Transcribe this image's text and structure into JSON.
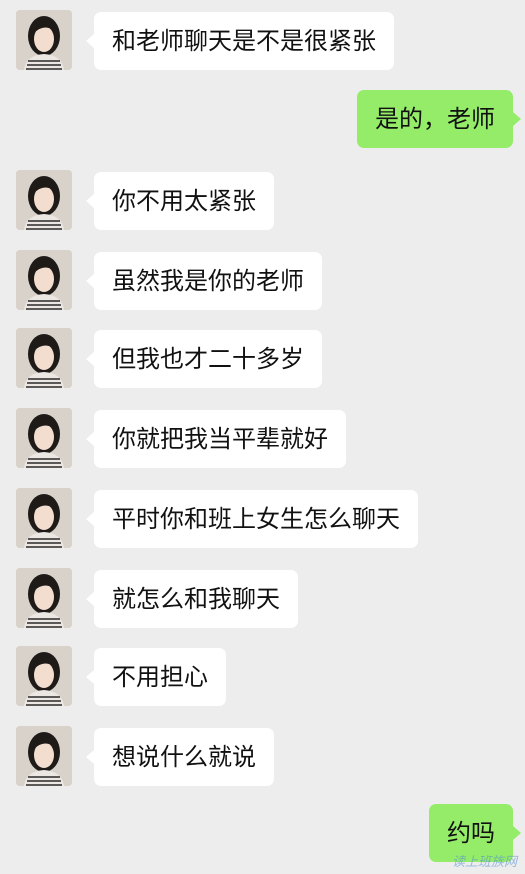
{
  "messages": [
    {
      "side": "in",
      "text": "和老师聊天是不是很紧张"
    },
    {
      "side": "out",
      "text": "是的，老师"
    },
    {
      "side": "in",
      "text": "你不用太紧张"
    },
    {
      "side": "in",
      "text": "虽然我是你的老师"
    },
    {
      "side": "in",
      "text": "但我也才二十多岁"
    },
    {
      "side": "in",
      "text": "你就把我当平辈就好"
    },
    {
      "side": "in",
      "text": "平时你和班上女生怎么聊天"
    },
    {
      "side": "in",
      "text": "就怎么和我聊天"
    },
    {
      "side": "in",
      "text": "不用担心"
    },
    {
      "side": "in",
      "text": "想说什么就说"
    },
    {
      "side": "out",
      "text": "约吗"
    }
  ],
  "watermark": "读上班族网",
  "colors": {
    "background": "#ededed",
    "incoming_bubble": "#ffffff",
    "outgoing_bubble": "#95ec69"
  }
}
